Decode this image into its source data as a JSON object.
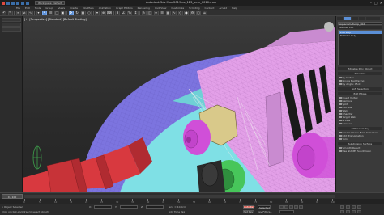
{
  "app": {
    "window_title": "Autodesk 3ds Max 2019   ax_123_oem_0010.max",
    "workspace": "Workspace: Default"
  },
  "menu": [
    "File",
    "Edit",
    "Tools",
    "Group",
    "Views",
    "Create",
    "Modifiers",
    "Animation",
    "Graph Editors",
    "Rendering",
    "Civil View",
    "Customize",
    "Scripting",
    "Content",
    "Arnold",
    "Help"
  ],
  "viewport": {
    "label": "[+] [Perspective] [Standard] [Default Shading]"
  },
  "command_panel": {
    "object_name": "Aquarium.Pump_002",
    "modifier_list": "Modifier List",
    "stack": [
      {
        "label": "Edit Poly",
        "selected": true
      },
      {
        "label": "Editable Poly",
        "selected": false
      }
    ],
    "rollouts": [
      {
        "title": "Editable Poly Object",
        "rows": []
      },
      {
        "title": "Selection",
        "rows": [
          {
            "label": "By Vertex",
            "checked": false
          },
          {
            "label": "Ignore Backfacing",
            "checked": false
          },
          {
            "label": "By Angle: 45.0",
            "checked": false
          }
        ]
      },
      {
        "title": "Soft Selection",
        "rows": []
      },
      {
        "title": "Edit Edges",
        "rows": [
          {
            "label": "Insert Vertex",
            "checked": false
          },
          {
            "label": "Remove",
            "checked": false
          },
          {
            "label": "Split",
            "checked": false
          },
          {
            "label": "Extrude",
            "checked": false
          },
          {
            "label": "Weld",
            "checked": false
          },
          {
            "label": "Chamfer",
            "checked": false
          },
          {
            "label": "Target Weld",
            "checked": false
          },
          {
            "label": "Bridge",
            "checked": false
          },
          {
            "label": "Connect",
            "checked": true
          }
        ]
      },
      {
        "title": "Edit Geometry",
        "rows": [
          {
            "label": "Create Shape From Selection",
            "checked": false
          },
          {
            "label": "Edit Triangulation",
            "checked": false
          },
          {
            "label": "Turn",
            "checked": false
          }
        ]
      },
      {
        "title": "Subdivision Surface",
        "rows": [
          {
            "label": "Smooth Result",
            "checked": false
          },
          {
            "label": "Use NURMS Subdivision",
            "checked": true
          }
        ]
      }
    ]
  },
  "timeline": {
    "slider_label": "0 / 100",
    "ticks": [
      "0",
      "5",
      "10",
      "15",
      "20",
      "25",
      "30",
      "35",
      "40",
      "45",
      "50",
      "55",
      "60",
      "65",
      "70",
      "75",
      "80",
      "85",
      "90",
      "95",
      "100"
    ]
  },
  "status": {
    "selection": "1 Object Selected",
    "hint": "Click or click-and-drag to select objects",
    "x_coord": "X:",
    "y_coord": "Y:",
    "z_coord": "Z:",
    "grid": "Grid = 10.0cm",
    "auto_key": "Auto Key",
    "set_key": "Set Key",
    "key_filters": "Key Filters...",
    "selected_dd": "Selected",
    "add_time_tag": "Add Time Tag"
  },
  "colors": {
    "selection_blue": "#5b8fd6",
    "autokey_red": "#d24a3e",
    "mesh_pink": "#e3a0e8",
    "mesh_blue": "#7c74df",
    "mesh_cyan": "#7fe0e5",
    "mesh_magenta": "#d04fd8",
    "mesh_red": "#d8393f",
    "mesh_green": "#47c65a",
    "mesh_yellow": "#d9c98a"
  }
}
